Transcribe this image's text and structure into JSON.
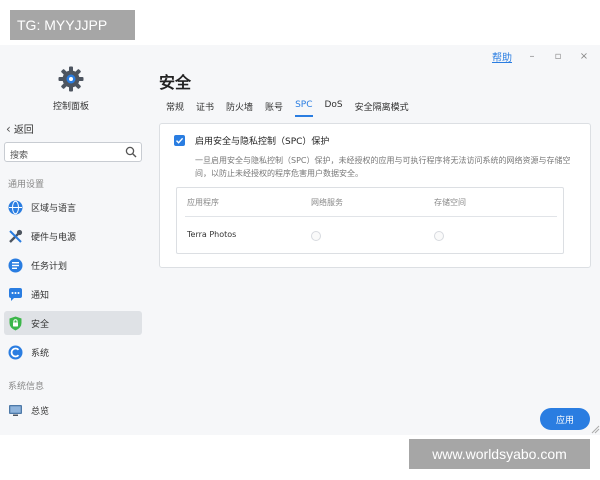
{
  "watermarks": {
    "top": "TG: MYYJJPP",
    "bottom": "www.worldsyabo.com"
  },
  "titlebar": {
    "help": "帮助",
    "minimize": "–",
    "maximize": "▫",
    "close": "×"
  },
  "sidebar": {
    "app_title": "控制面板",
    "back_label": "返回",
    "search": {
      "placeholder": "搜索",
      "value": ""
    },
    "group_general": "通用设置",
    "group_info": "系统信息",
    "items": [
      {
        "label": "区域与语言",
        "icon": "globe-icon"
      },
      {
        "label": "硬件与电源",
        "icon": "tools-icon"
      },
      {
        "label": "任务计划",
        "icon": "task-list-icon"
      },
      {
        "label": "通知",
        "icon": "chat-bubble-icon"
      },
      {
        "label": "安全",
        "icon": "shield-icon",
        "active": true
      },
      {
        "label": "系统",
        "icon": "system-icon"
      },
      {
        "label": "总览",
        "icon": "monitor-icon"
      }
    ]
  },
  "main": {
    "title": "安全",
    "tabs": [
      "常规",
      "证书",
      "防火墙",
      "账号",
      "SPC",
      "DoS",
      "安全隔离模式"
    ],
    "active_tab": "SPC",
    "spc": {
      "checkbox_label": "启用安全与隐私控制（SPC）保护",
      "checked": true,
      "description": "一旦启用安全与隐私控制（SPC）保护，未经授权的应用与可执行程序将无法访问系统的网络资源与存储空间，以防止未经授权的程序危害用户数据安全。",
      "table": {
        "headers": [
          "应用程序",
          "网络服务",
          "存储空间"
        ],
        "rows": [
          {
            "app": "Terra Photos"
          }
        ]
      }
    },
    "apply_label": "应用"
  },
  "colors": {
    "accent": "#2a7de1",
    "active_nav_bg": "#dfe2e6",
    "watermark_bg": "#a6a6a6"
  }
}
